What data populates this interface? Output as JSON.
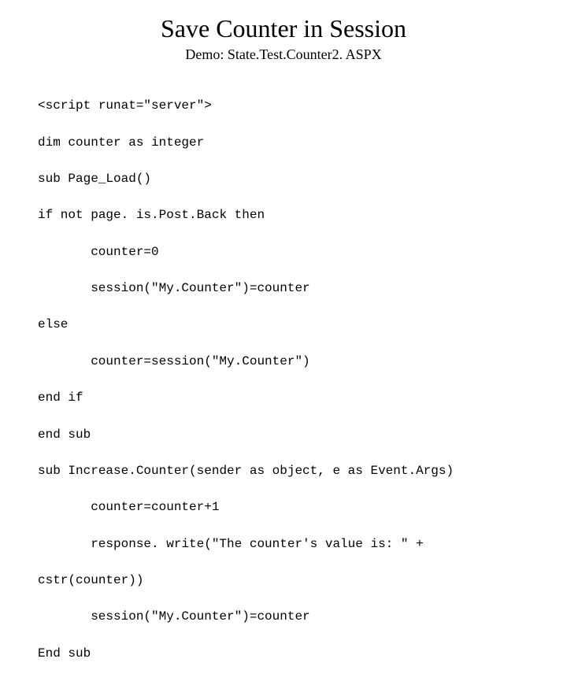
{
  "title": "Save Counter in Session",
  "subtitle": "Demo: State.Test.Counter2. ASPX",
  "code": {
    "l1": "<script runat=\"server\">",
    "l2": "dim counter as integer",
    "l3": "sub Page_Load()",
    "l4": "if not page. is.Post.Back then",
    "l5": "counter=0",
    "l6": "session(\"My.Counter\")=counter",
    "l7": "else",
    "l8": "counter=session(\"My.Counter\")",
    "l9": "end if",
    "l10": "end sub",
    "l11": "sub Increase.Counter(sender as object, e as Event.Args)",
    "l12": "counter=counter+1",
    "l13": "response. write(\"The counter's value is: \" +",
    "l14": "cstr(counter))",
    "l15": "session(\"My.Counter\")=counter",
    "l16": "End sub"
  }
}
